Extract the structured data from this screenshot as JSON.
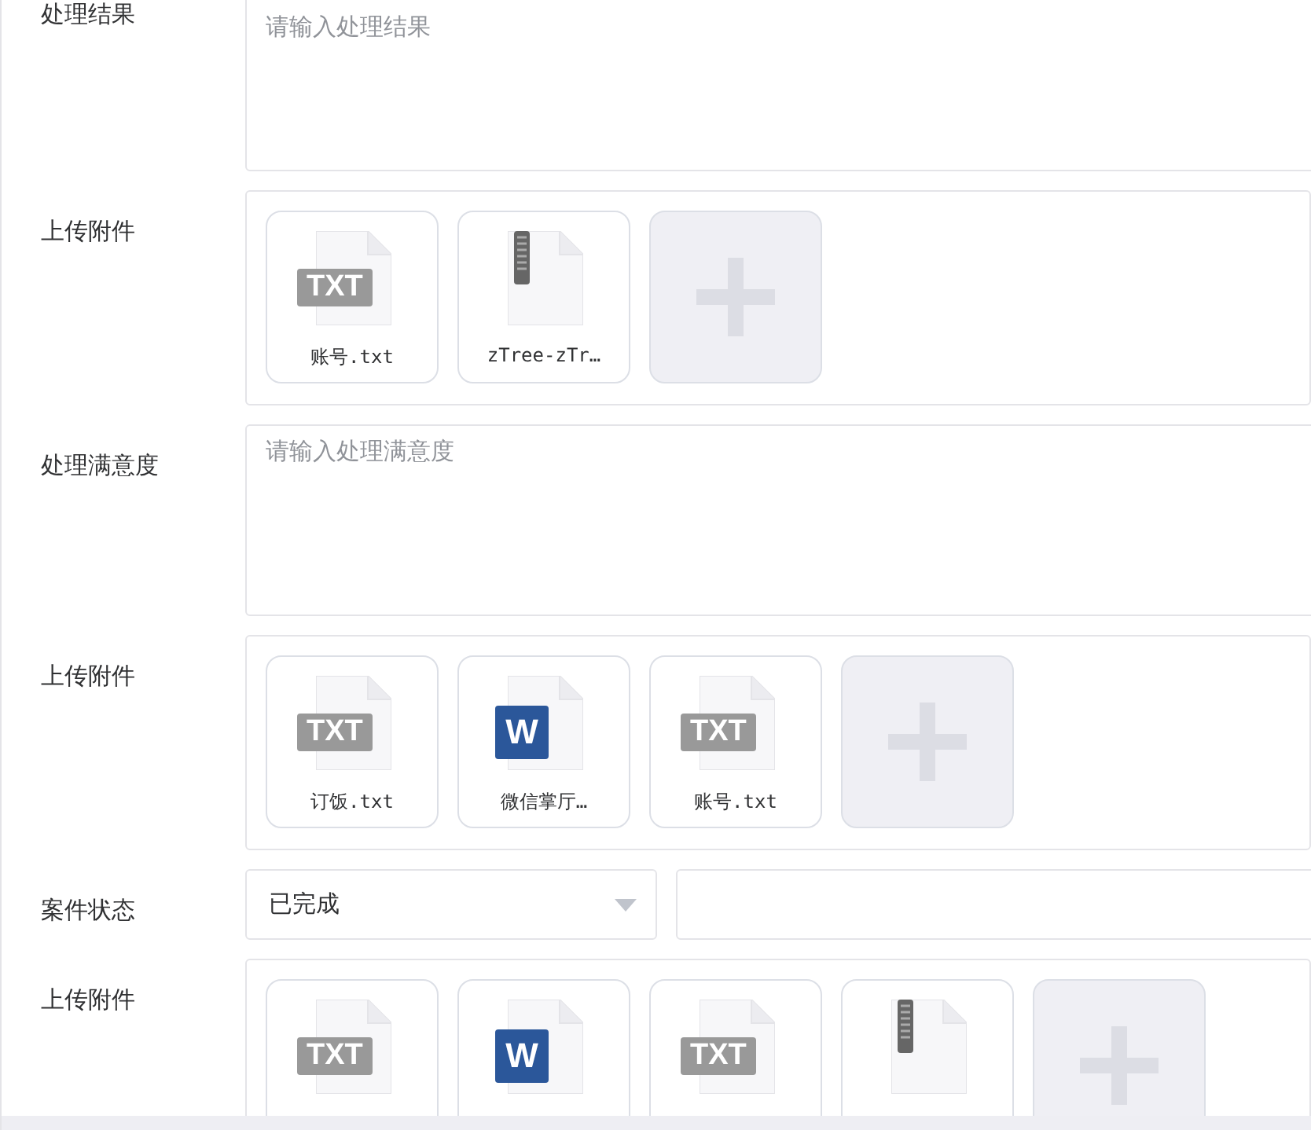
{
  "rows": [
    {
      "label": "处理结果",
      "kind": "textarea",
      "placeholder": "请输入处理结果"
    },
    {
      "label": "上传附件",
      "kind": "upload",
      "files": [
        {
          "kind": "txt",
          "badge": "TXT",
          "name": "账号.txt"
        },
        {
          "kind": "zip",
          "name": "zTree-zTr…"
        }
      ]
    },
    {
      "label": "处理满意度",
      "kind": "textarea",
      "placeholder": "请输入处理满意度"
    },
    {
      "label": "上传附件",
      "kind": "upload",
      "files": [
        {
          "kind": "txt",
          "badge": "TXT",
          "name": "订饭.txt"
        },
        {
          "kind": "word",
          "badge": "W",
          "name": "微信掌厅…"
        },
        {
          "kind": "txt",
          "badge": "TXT",
          "name": "账号.txt"
        }
      ]
    },
    {
      "label": "案件状态",
      "kind": "select",
      "value": "已完成"
    },
    {
      "label": "上传附件",
      "kind": "upload",
      "files": [
        {
          "kind": "txt",
          "badge": "TXT"
        },
        {
          "kind": "word",
          "badge": "W"
        },
        {
          "kind": "txt",
          "badge": "TXT"
        },
        {
          "kind": "zip"
        }
      ]
    }
  ]
}
